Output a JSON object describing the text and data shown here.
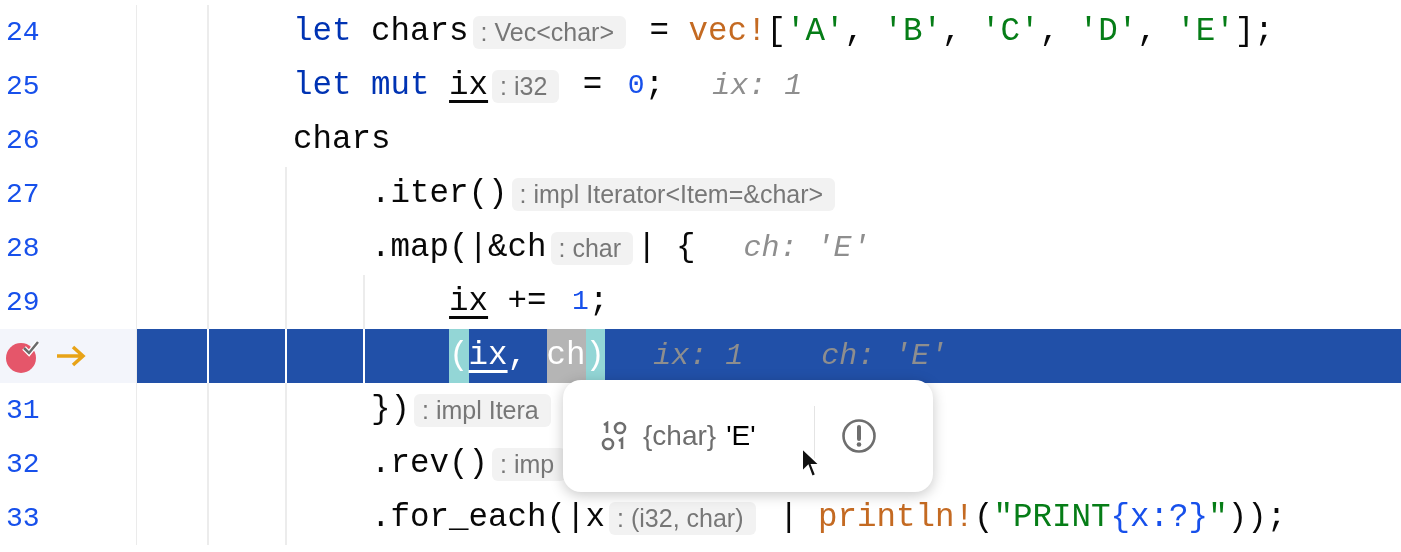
{
  "editor": {
    "lines": [
      {
        "number": "24",
        "current": false,
        "breakpoint": false,
        "execution_point": false,
        "segments": [
          {
            "kind": "code",
            "tokens": [
              {
                "kind": "kw",
                "text": "        let "
              },
              {
                "kind": "plain",
                "text": "chars"
              }
            ]
          },
          {
            "kind": "hint",
            "text": ": Vec<char>"
          },
          {
            "kind": "code",
            "tokens": [
              {
                "kind": "plain",
                "text": " = "
              },
              {
                "kind": "macro",
                "text": "vec!"
              },
              {
                "kind": "plain",
                "text": "["
              },
              {
                "kind": "str",
                "text": "'A'"
              },
              {
                "kind": "plain",
                "text": ", "
              },
              {
                "kind": "str",
                "text": "'B'"
              },
              {
                "kind": "plain",
                "text": ", "
              },
              {
                "kind": "str",
                "text": "'C'"
              },
              {
                "kind": "plain",
                "text": ", "
              },
              {
                "kind": "str",
                "text": "'D'"
              },
              {
                "kind": "plain",
                "text": ", "
              },
              {
                "kind": "str",
                "text": "'E'"
              },
              {
                "kind": "plain",
                "text": "];"
              }
            ]
          }
        ]
      },
      {
        "number": "25",
        "current": false,
        "breakpoint": false,
        "execution_point": false,
        "segments": [
          {
            "kind": "code",
            "tokens": [
              {
                "kind": "kw",
                "text": "        let mut "
              },
              {
                "kind": "var",
                "text": "ix"
              }
            ]
          },
          {
            "kind": "hint",
            "text": ": i32"
          },
          {
            "kind": "code",
            "tokens": [
              {
                "kind": "plain",
                "text": " = "
              },
              {
                "kind": "num",
                "text": "0"
              },
              {
                "kind": "plain",
                "text": ";"
              }
            ]
          },
          {
            "kind": "debug",
            "text": "ix: 1"
          }
        ]
      },
      {
        "number": "26",
        "current": false,
        "breakpoint": false,
        "execution_point": false,
        "segments": [
          {
            "kind": "code",
            "tokens": [
              {
                "kind": "plain",
                "text": "        chars"
              }
            ]
          }
        ]
      },
      {
        "number": "27",
        "current": false,
        "breakpoint": false,
        "execution_point": false,
        "segments": [
          {
            "kind": "code",
            "tokens": [
              {
                "kind": "plain",
                "text": "            .iter()"
              }
            ]
          },
          {
            "kind": "hint",
            "text": ": impl Iterator<Item=&char>"
          }
        ]
      },
      {
        "number": "28",
        "current": false,
        "breakpoint": false,
        "execution_point": false,
        "segments": [
          {
            "kind": "code",
            "tokens": [
              {
                "kind": "plain",
                "text": "            .map(|&ch"
              }
            ]
          },
          {
            "kind": "hint",
            "text": ": char"
          },
          {
            "kind": "code",
            "tokens": [
              {
                "kind": "plain",
                "text": "| {"
              }
            ]
          },
          {
            "kind": "debug",
            "text": "ch: 'E'"
          }
        ]
      },
      {
        "number": "29",
        "current": false,
        "breakpoint": false,
        "execution_point": false,
        "segments": [
          {
            "kind": "code",
            "tokens": [
              {
                "kind": "var",
                "text": "                ix"
              },
              {
                "kind": "plain",
                "text": " += "
              },
              {
                "kind": "num",
                "text": "1"
              },
              {
                "kind": "plain",
                "text": ";"
              }
            ]
          }
        ]
      },
      {
        "current": true,
        "breakpoint": true,
        "execution_point": true,
        "segments": [
          {
            "kind": "code",
            "tokens": [
              {
                "kind": "brace-match",
                "text": "                ("
              },
              {
                "kind": "var",
                "text": "ix"
              },
              {
                "kind": "plain",
                "text": ", "
              },
              {
                "kind": "selected",
                "text": "ch"
              },
              {
                "kind": "brace-match",
                "text": ")"
              }
            ]
          },
          {
            "kind": "debug",
            "text": "ix: 1"
          },
          {
            "kind": "debug",
            "text": "ch: 'E'"
          }
        ]
      },
      {
        "number": "31",
        "current": false,
        "breakpoint": false,
        "execution_point": false,
        "segments": [
          {
            "kind": "code",
            "tokens": [
              {
                "kind": "plain",
                "text": "            })"
              }
            ]
          },
          {
            "kind": "hint",
            "text": ": impl Itera"
          }
        ]
      },
      {
        "number": "32",
        "current": false,
        "breakpoint": false,
        "execution_point": false,
        "segments": [
          {
            "kind": "code",
            "tokens": [
              {
                "kind": "plain",
                "text": "            .rev()"
              }
            ]
          },
          {
            "kind": "hint",
            "text": ": imp"
          }
        ]
      },
      {
        "number": "33",
        "current": false,
        "breakpoint": false,
        "execution_point": false,
        "segments": [
          {
            "kind": "code",
            "tokens": [
              {
                "kind": "plain",
                "text": "            .for_each(|x"
              }
            ]
          },
          {
            "kind": "hint",
            "text": ": (i32, char)"
          },
          {
            "kind": "code",
            "tokens": [
              {
                "kind": "plain",
                "text": " | "
              },
              {
                "kind": "macro",
                "text": "println!"
              },
              {
                "kind": "plain",
                "text": "("
              },
              {
                "kind": "str",
                "text": "\"PRINT"
              },
              {
                "kind": "fmt",
                "text": "{x:?}"
              },
              {
                "kind": "str",
                "text": "\""
              },
              {
                "kind": "plain",
                "text": "));"
              }
            ]
          }
        ]
      }
    ]
  },
  "value_popup": {
    "type": "{char}",
    "value": "'E'"
  }
}
